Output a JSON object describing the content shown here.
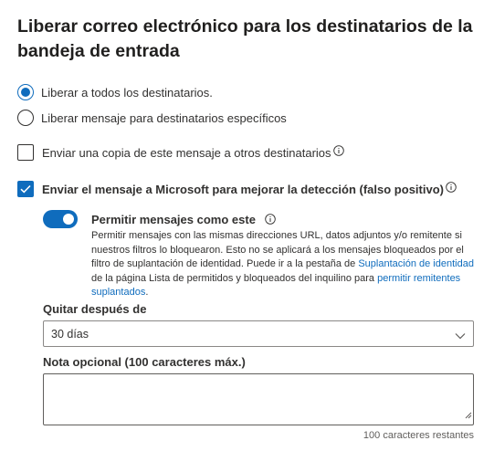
{
  "panel": {
    "title": "Liberar correo electrónico para los destinatarios de la bandeja de entrada"
  },
  "release_options": [
    {
      "label": "Liberar a todos los destinatarios.",
      "selected": true
    },
    {
      "label": "Liberar mensaje para destinatarios específicos",
      "selected": false
    }
  ],
  "send_copy": {
    "label": "Enviar una copia de este mensaje a otros destinatarios",
    "checked": false,
    "icon": "info-icon"
  },
  "report_microsoft": {
    "label": "Enviar el mensaje a Microsoft para mejorar la detección (falso positivo)",
    "checked": true,
    "icon": "info-icon"
  },
  "allow_messages": {
    "label": "Permitir mensajes como este",
    "enabled": true,
    "description_part1": "Permitir mensajes con las mismas direcciones URL, datos adjuntos y/o remitente si nuestros filtros lo bloquearon. Esto no se aplicará a los mensajes bloqueados por el filtro de suplantación de identidad. Puede ir a la pestaña de ",
    "link1": "Suplantación de identidad",
    "description_part2": " de la página Lista de permitidos y bloqueados del inquilino para ",
    "link2": "permitir remitentes suplantados",
    "description_part3": "."
  },
  "remove_after": {
    "label": "Quitar después de",
    "value": "30 días"
  },
  "optional_note": {
    "label": "Nota opcional (100 caracteres máx.)",
    "value": "",
    "counter": "100 caracteres restantes"
  },
  "colors": {
    "accent": "#0f6cbd",
    "text": "#323130"
  }
}
